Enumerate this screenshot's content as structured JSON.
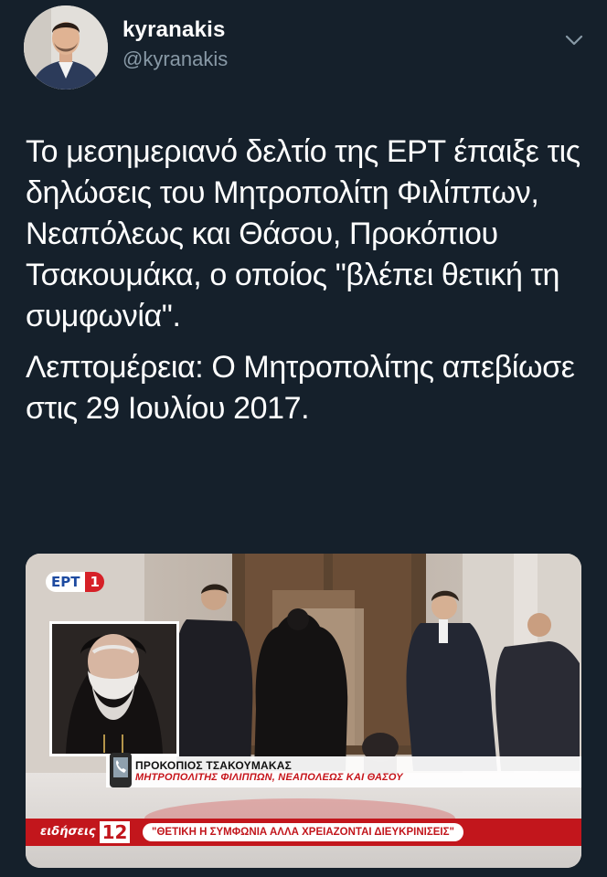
{
  "user": {
    "display_name": "kyranakis",
    "handle": "@kyranakis"
  },
  "icons": {
    "menu": "chevron-down-icon",
    "phone": "phone-icon"
  },
  "tweet": {
    "paragraph_1": "Το μεσημεριανό δελτίο της ΕΡΤ έπαιξε τις δηλώσεις του Μητροπολίτη Φιλίππων, Νεαπόλεως και Θάσου, Προκόπιου Τσακουμάκα, ο οποίος \"βλέπει θετική τη συμφωνία\".",
    "paragraph_2": "Λεπτομέρεια: Ο Μητροπολίτης απεβίωσε στις 29 Ιουλίου 2017."
  },
  "media": {
    "channel_logo": "ΕΡΤ",
    "channel_number": "1",
    "caption_name": "ΠΡΟΚΟΠΙΟΣ ΤΣΑΚΟΥΜΑΚΑΣ",
    "caption_title": "ΜΗΤΡΟΠΟΛΙΤΗΣ ΦΙΛΙΠΠΩΝ, ΝΕΑΠΟΛΕΩΣ ΚΑΙ ΘΑΣΟΥ",
    "news_label": "ειδήσεις",
    "news_number": "12",
    "headline": "\"ΘΕΤΙΚΗ Η ΣΥΜΦΩΝΙΑ ΑΛΛΑ ΧΡΕΙΑΖΟΝΤΑΙ ΔΙΕΥΚΡΙΝΙΣΕΙΣ\""
  },
  "colors": {
    "background": "#15202b",
    "secondary_text": "#8899a6",
    "primary_text": "#ffffff",
    "ert_red": "#c2161c",
    "ert_blue": "#1d4aa0"
  }
}
